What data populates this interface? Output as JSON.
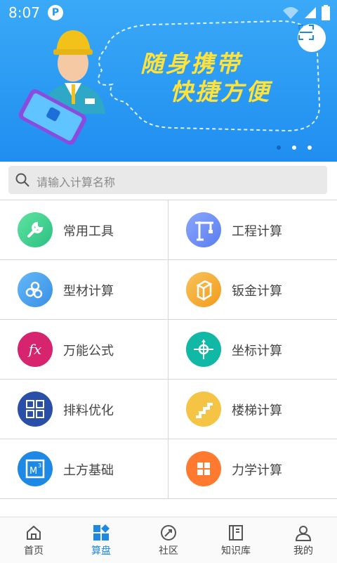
{
  "status_bar": {
    "time": "8:07",
    "app_badge": "P"
  },
  "banner": {
    "line1": "随身携带",
    "line2": "快捷方便"
  },
  "search": {
    "placeholder": "请输入计算名称"
  },
  "grid": [
    {
      "label": "常用工具",
      "icon": "wrench-icon",
      "color": "#3ccf8e"
    },
    {
      "label": "工程计算",
      "icon": "crane-icon",
      "color": "#6b8ff7"
    },
    {
      "label": "型材计算",
      "icon": "pipes-icon",
      "color": "#4aa3f0"
    },
    {
      "label": "钣金计算",
      "icon": "sheet-metal-icon",
      "color": "#f5a623"
    },
    {
      "label": "万能公式",
      "icon": "function-icon",
      "color": "#d6246e"
    },
    {
      "label": "坐标计算",
      "icon": "coordinate-icon",
      "color": "#12b8a6"
    },
    {
      "label": "排料优化",
      "icon": "layout-icon",
      "color": "#2a4fa8"
    },
    {
      "label": "楼梯计算",
      "icon": "stairs-icon",
      "color": "#f6c445"
    },
    {
      "label": "土方基础",
      "icon": "cube-m3-icon",
      "color": "#1e88e5"
    },
    {
      "label": "力学计算",
      "icon": "grid-icon",
      "color": "#ff7a2f"
    }
  ],
  "tabs": [
    {
      "label": "首页",
      "icon": "home-icon"
    },
    {
      "label": "算盘",
      "icon": "apps-icon",
      "active": true
    },
    {
      "label": "社区",
      "icon": "community-icon"
    },
    {
      "label": "知识库",
      "icon": "book-icon"
    },
    {
      "label": "我的",
      "icon": "person-icon"
    }
  ],
  "colors": {
    "accent": "#1e88e5",
    "banner_text": "#ffe23a"
  }
}
